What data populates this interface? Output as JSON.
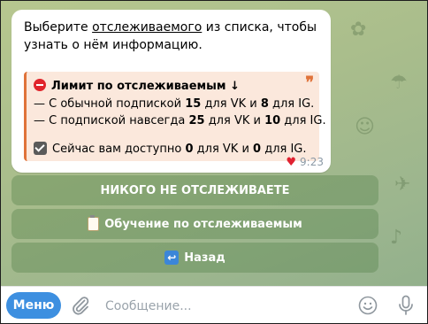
{
  "message": {
    "intro_before": "Выберите ",
    "intro_link": "отслеживаемого",
    "intro_after": " из списка, чтобы узнать о нём информацию.",
    "quote": {
      "title": "Лимит по отслеживаемым",
      "title_arrow": "↓",
      "line1": {
        "prefix": "— С обычной подпиской ",
        "vk": "15",
        "mid": " для VK и ",
        "ig": "8",
        "suffix": " для IG."
      },
      "line2": {
        "prefix": "— С подпиской навсегда ",
        "vk": "25",
        "mid": " для VK и ",
        "ig": "10",
        "suffix": " для IG."
      },
      "line3": {
        "prefix": "Сейчас вам доступно ",
        "vk": "0",
        "mid": " для VK и ",
        "ig": "0",
        "suffix": " для IG."
      }
    },
    "reaction": "♥",
    "time": "9:23"
  },
  "keyboard": {
    "btn1": "НИКОГО НЕ ОТСЛЕЖИВАЕТЕ",
    "btn2": "Обучение по отслеживаемым",
    "btn3": "Назад"
  },
  "composer": {
    "menu_label": "Меню",
    "placeholder": "Сообщение..."
  },
  "colors": {
    "accent": "#3d8fe0",
    "quote_border": "#e0733a",
    "heart": "#e02231"
  },
  "icons": [
    "stop-icon",
    "check-icon",
    "clipboard-icon",
    "back-arrow-icon",
    "paperclip-icon",
    "emoji-icon",
    "microphone-icon"
  ]
}
